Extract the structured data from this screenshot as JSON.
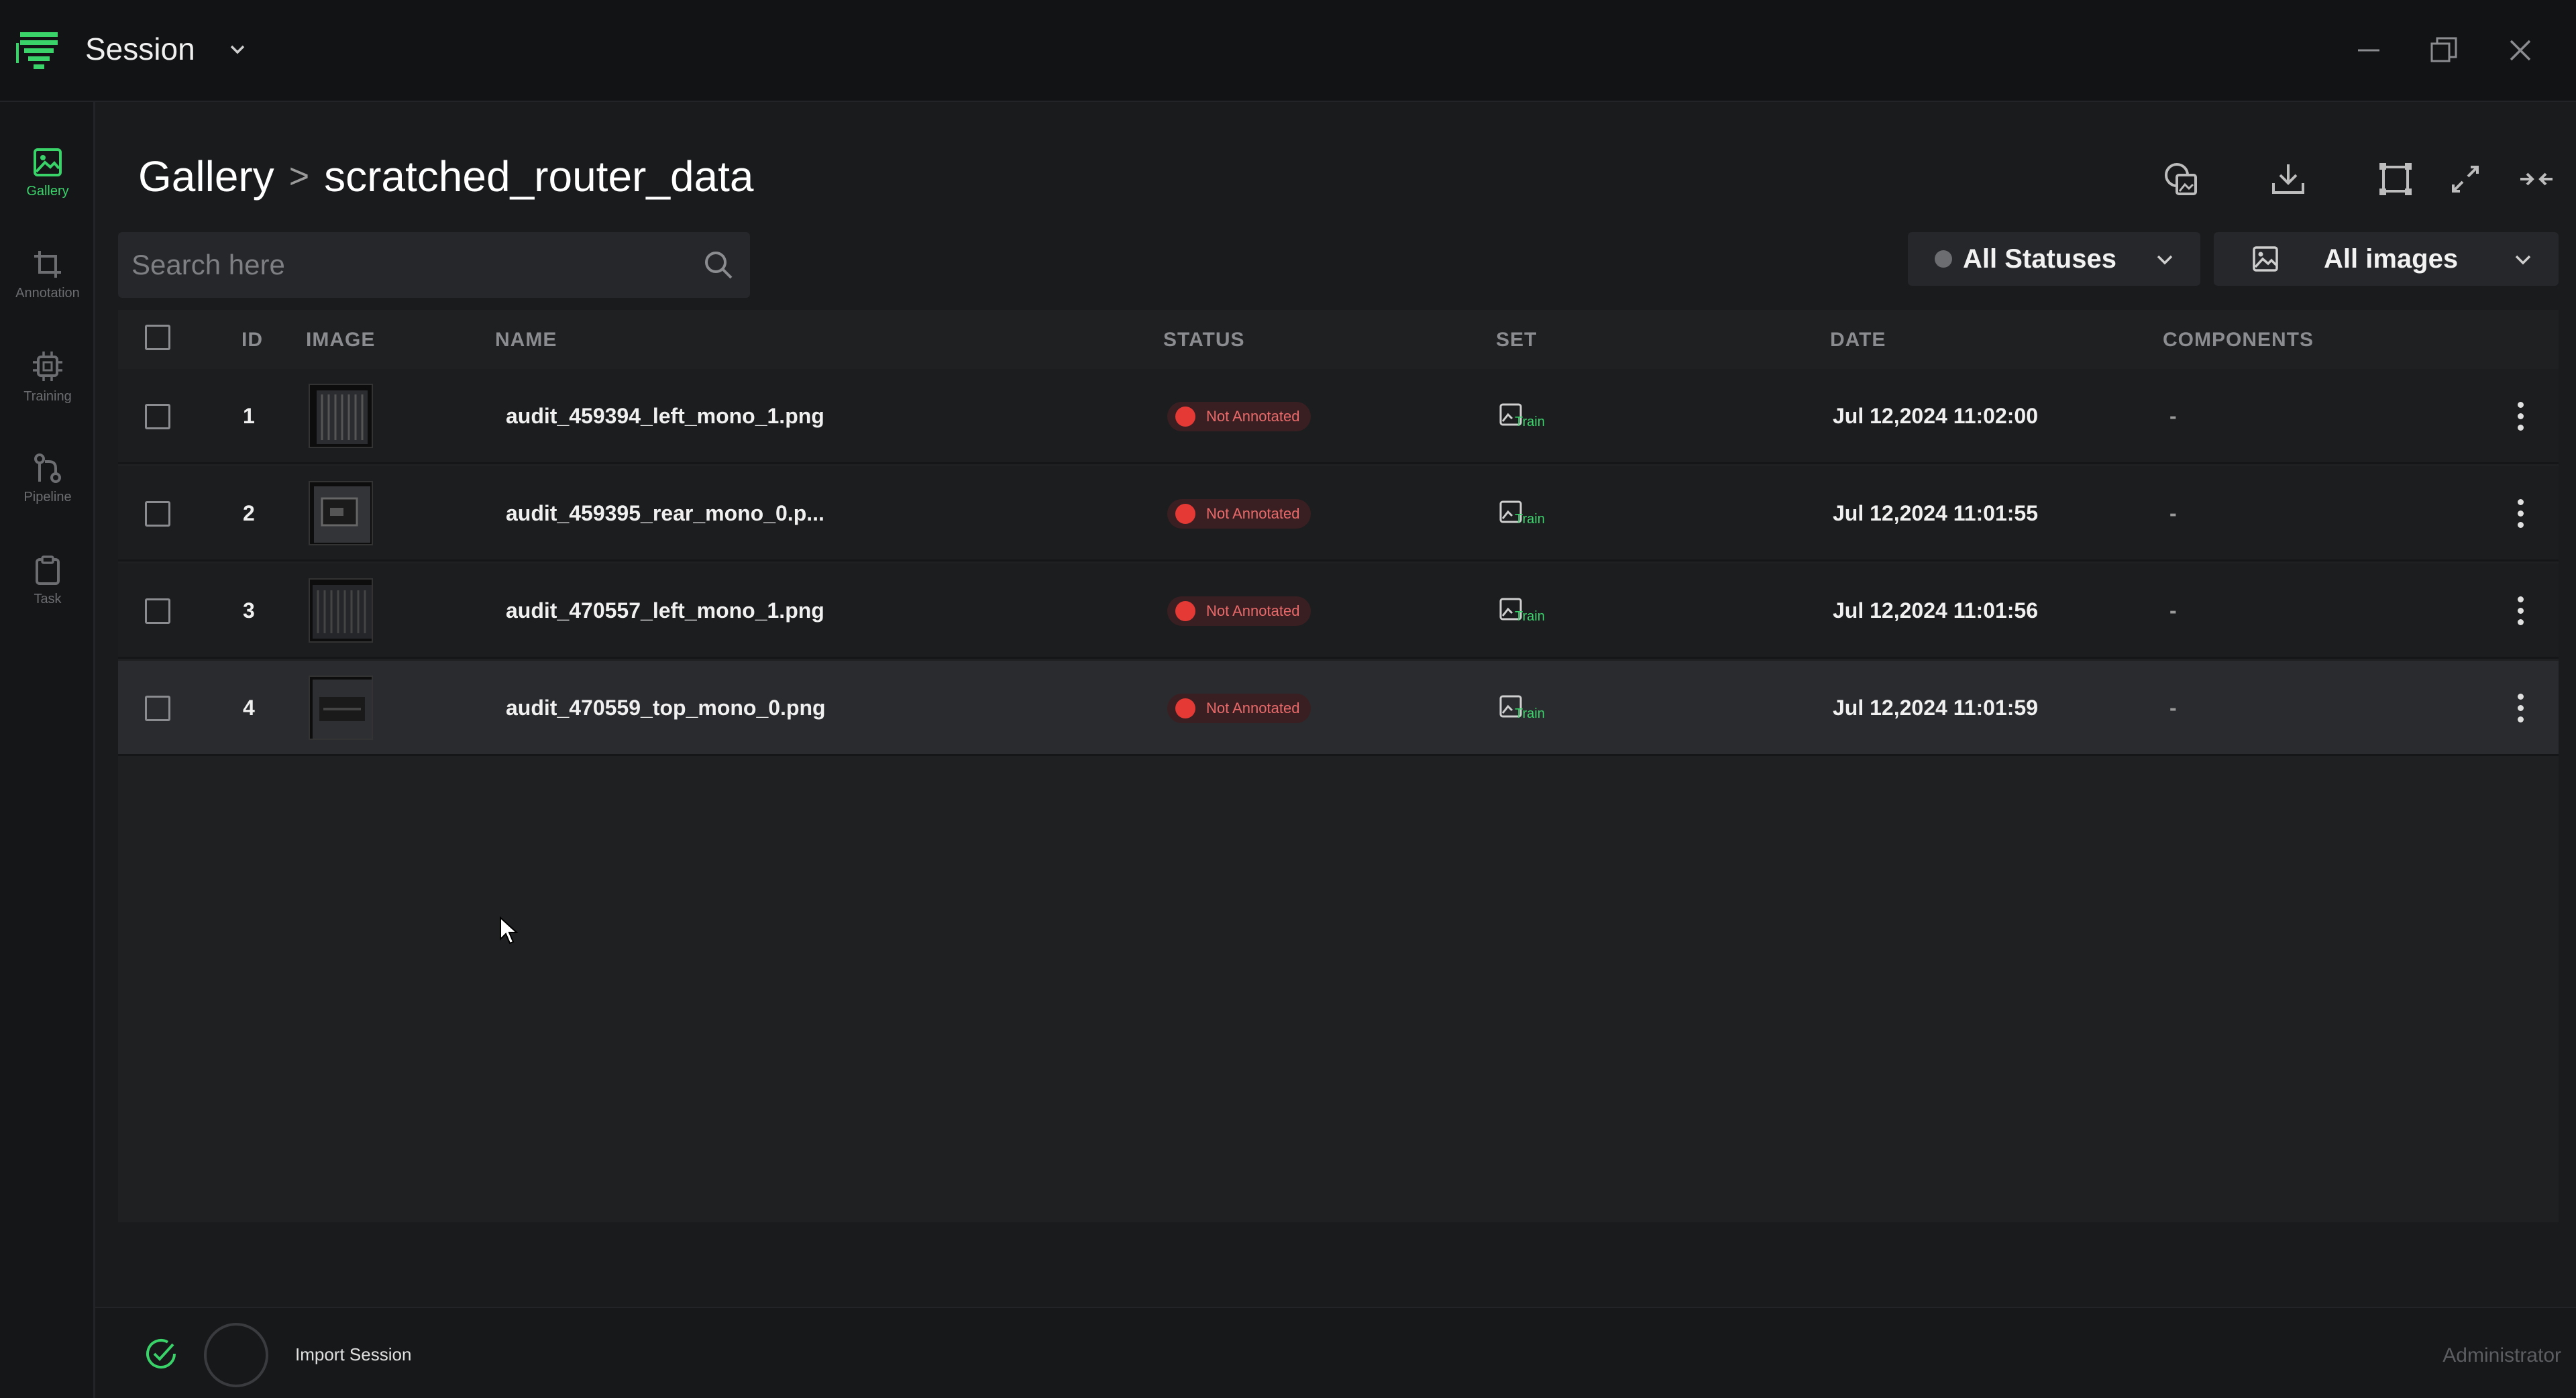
{
  "app": {
    "title": "Session",
    "brand_color": "#3ad36a"
  },
  "window_controls": [
    "minimize-icon",
    "restore-icon",
    "close-icon"
  ],
  "sidebar": {
    "items": [
      {
        "label": "Gallery",
        "icon": "gallery-icon",
        "active": true
      },
      {
        "label": "Annotation",
        "icon": "crop-icon",
        "active": false
      },
      {
        "label": "Training",
        "icon": "chip-icon",
        "active": false
      },
      {
        "label": "Pipeline",
        "icon": "pipeline-icon",
        "active": false
      },
      {
        "label": "Task",
        "icon": "clipboard-icon",
        "active": false
      }
    ]
  },
  "header": {
    "breadcrumb_root": "Gallery",
    "breadcrumb_separator": ">",
    "breadcrumb_current": "scratched_router_data",
    "toolbar_icons": [
      "image-compare-icon",
      "download-icon",
      "frame-icon",
      "expand-icon",
      "collapse-icon"
    ]
  },
  "search": {
    "placeholder": "Search here",
    "value": ""
  },
  "filters": {
    "status_label": "All Statuses",
    "images_label": "All images"
  },
  "table": {
    "columns": {
      "id": "ID",
      "image": "IMAGE",
      "name": "NAME",
      "status": "STATUS",
      "set": "SET",
      "date": "DATE",
      "components": "COMPONENTS"
    },
    "rows": [
      {
        "id": "1",
        "name": "audit_459394_left_mono_1.png",
        "status": "Not Annotated",
        "set": "Train",
        "date": "Jul 12,2024 11:02:00",
        "components": "-"
      },
      {
        "id": "2",
        "name": "audit_459395_rear_mono_0.p...",
        "status": "Not Annotated",
        "set": "Train",
        "date": "Jul 12,2024 11:01:55",
        "components": "-"
      },
      {
        "id": "3",
        "name": "audit_470557_left_mono_1.png",
        "status": "Not Annotated",
        "set": "Train",
        "date": "Jul 12,2024 11:01:56",
        "components": "-"
      },
      {
        "id": "4",
        "name": "audit_470559_top_mono_0.png",
        "status": "Not Annotated",
        "set": "Train",
        "date": "Jul 12,2024 11:01:59",
        "components": "-"
      }
    ]
  },
  "footer": {
    "import_label": "Import Session",
    "user_label": "Administrator"
  }
}
